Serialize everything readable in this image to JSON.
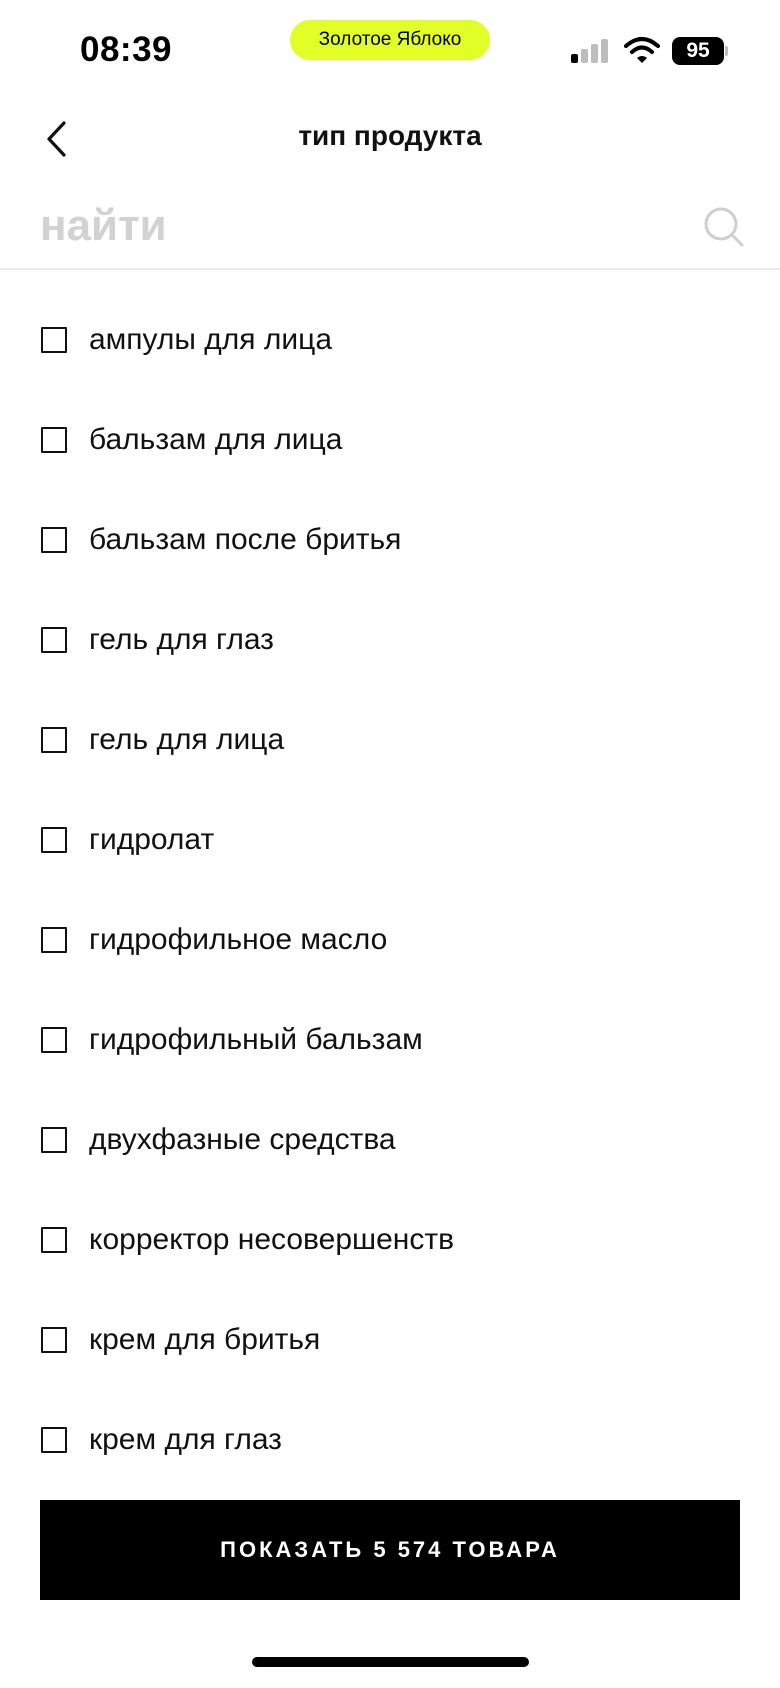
{
  "status_bar": {
    "time": "08:39",
    "app_pill": "Золотое Яблоко",
    "battery": "95",
    "pill_color": "#e1ff26"
  },
  "header": {
    "title": "тип продукта",
    "back_icon": "chevron-left-icon"
  },
  "search": {
    "placeholder": "найти",
    "value": "",
    "icon": "search-icon"
  },
  "items": [
    {
      "label": "ампулы для лица",
      "checked": false
    },
    {
      "label": "бальзам для лица",
      "checked": false
    },
    {
      "label": "бальзам после бритья",
      "checked": false
    },
    {
      "label": "гель для глаз",
      "checked": false
    },
    {
      "label": "гель для лица",
      "checked": false
    },
    {
      "label": "гидролат",
      "checked": false
    },
    {
      "label": "гидрофильное масло",
      "checked": false
    },
    {
      "label": "гидрофильный бальзам",
      "checked": false
    },
    {
      "label": "двухфазные средства",
      "checked": false
    },
    {
      "label": "корректор несовершенств",
      "checked": false
    },
    {
      "label": "крем для бритья",
      "checked": false
    },
    {
      "label": "крем для глаз",
      "checked": false
    }
  ],
  "footer": {
    "show_button": "ПОКАЗАТЬ 5 574 ТОВАРА"
  }
}
